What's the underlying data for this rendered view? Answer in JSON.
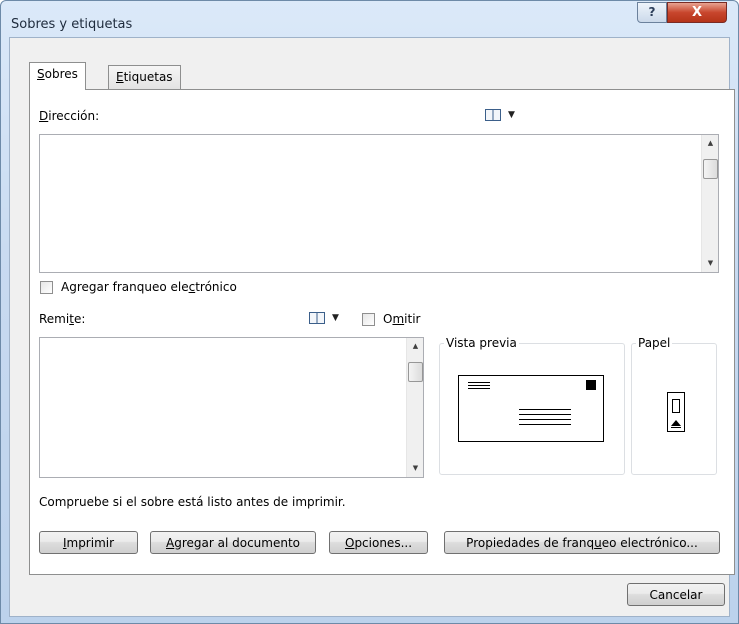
{
  "window": {
    "title": "Sobres y etiquetas",
    "help_glyph": "?",
    "close_glyph": "X"
  },
  "tabs": [
    {
      "pre": "",
      "key": "S",
      "post": "obres",
      "active": true
    },
    {
      "pre": "",
      "key": "E",
      "post": "tiquetas",
      "active": false
    }
  ],
  "delivery": {
    "label_pre": "",
    "label_key": "D",
    "label_post": "irección:",
    "address_value": "",
    "book_icon": "address-book-icon",
    "book_menu_glyph": "▼"
  },
  "epostage": {
    "pre": "Agregar franqueo ele",
    "key": "c",
    "post": "trónico",
    "checked": false
  },
  "return": {
    "label_pre": "Remi",
    "label_key": "t",
    "label_post": "e:",
    "address_value": "",
    "book_icon": "address-book-icon",
    "book_menu_glyph": "▼",
    "omit_pre": "O",
    "omit_key": "m",
    "omit_post": "itir",
    "omit_checked": false
  },
  "preview": {
    "legend": "Vista previa"
  },
  "paper": {
    "legend": "Papel"
  },
  "status_text": "Compruebe si el sobre está listo antes de imprimir.",
  "buttons": {
    "print": {
      "pre": "",
      "key": "I",
      "post": "mprimir"
    },
    "add": {
      "pre": "",
      "key": "A",
      "post": "gregar al documento"
    },
    "options": {
      "pre": "",
      "key": "O",
      "post": "pciones..."
    },
    "epostage_props": {
      "pre": "Propiedades de franq",
      "key": "u",
      "post": "eo electrónico..."
    },
    "cancel": {
      "label": "Cancelar"
    }
  },
  "scroll_glyphs": {
    "up": "▲",
    "down": "▼"
  },
  "colors": {
    "close_red": "#c8462d",
    "frame_blue": "#c9dbf1"
  }
}
